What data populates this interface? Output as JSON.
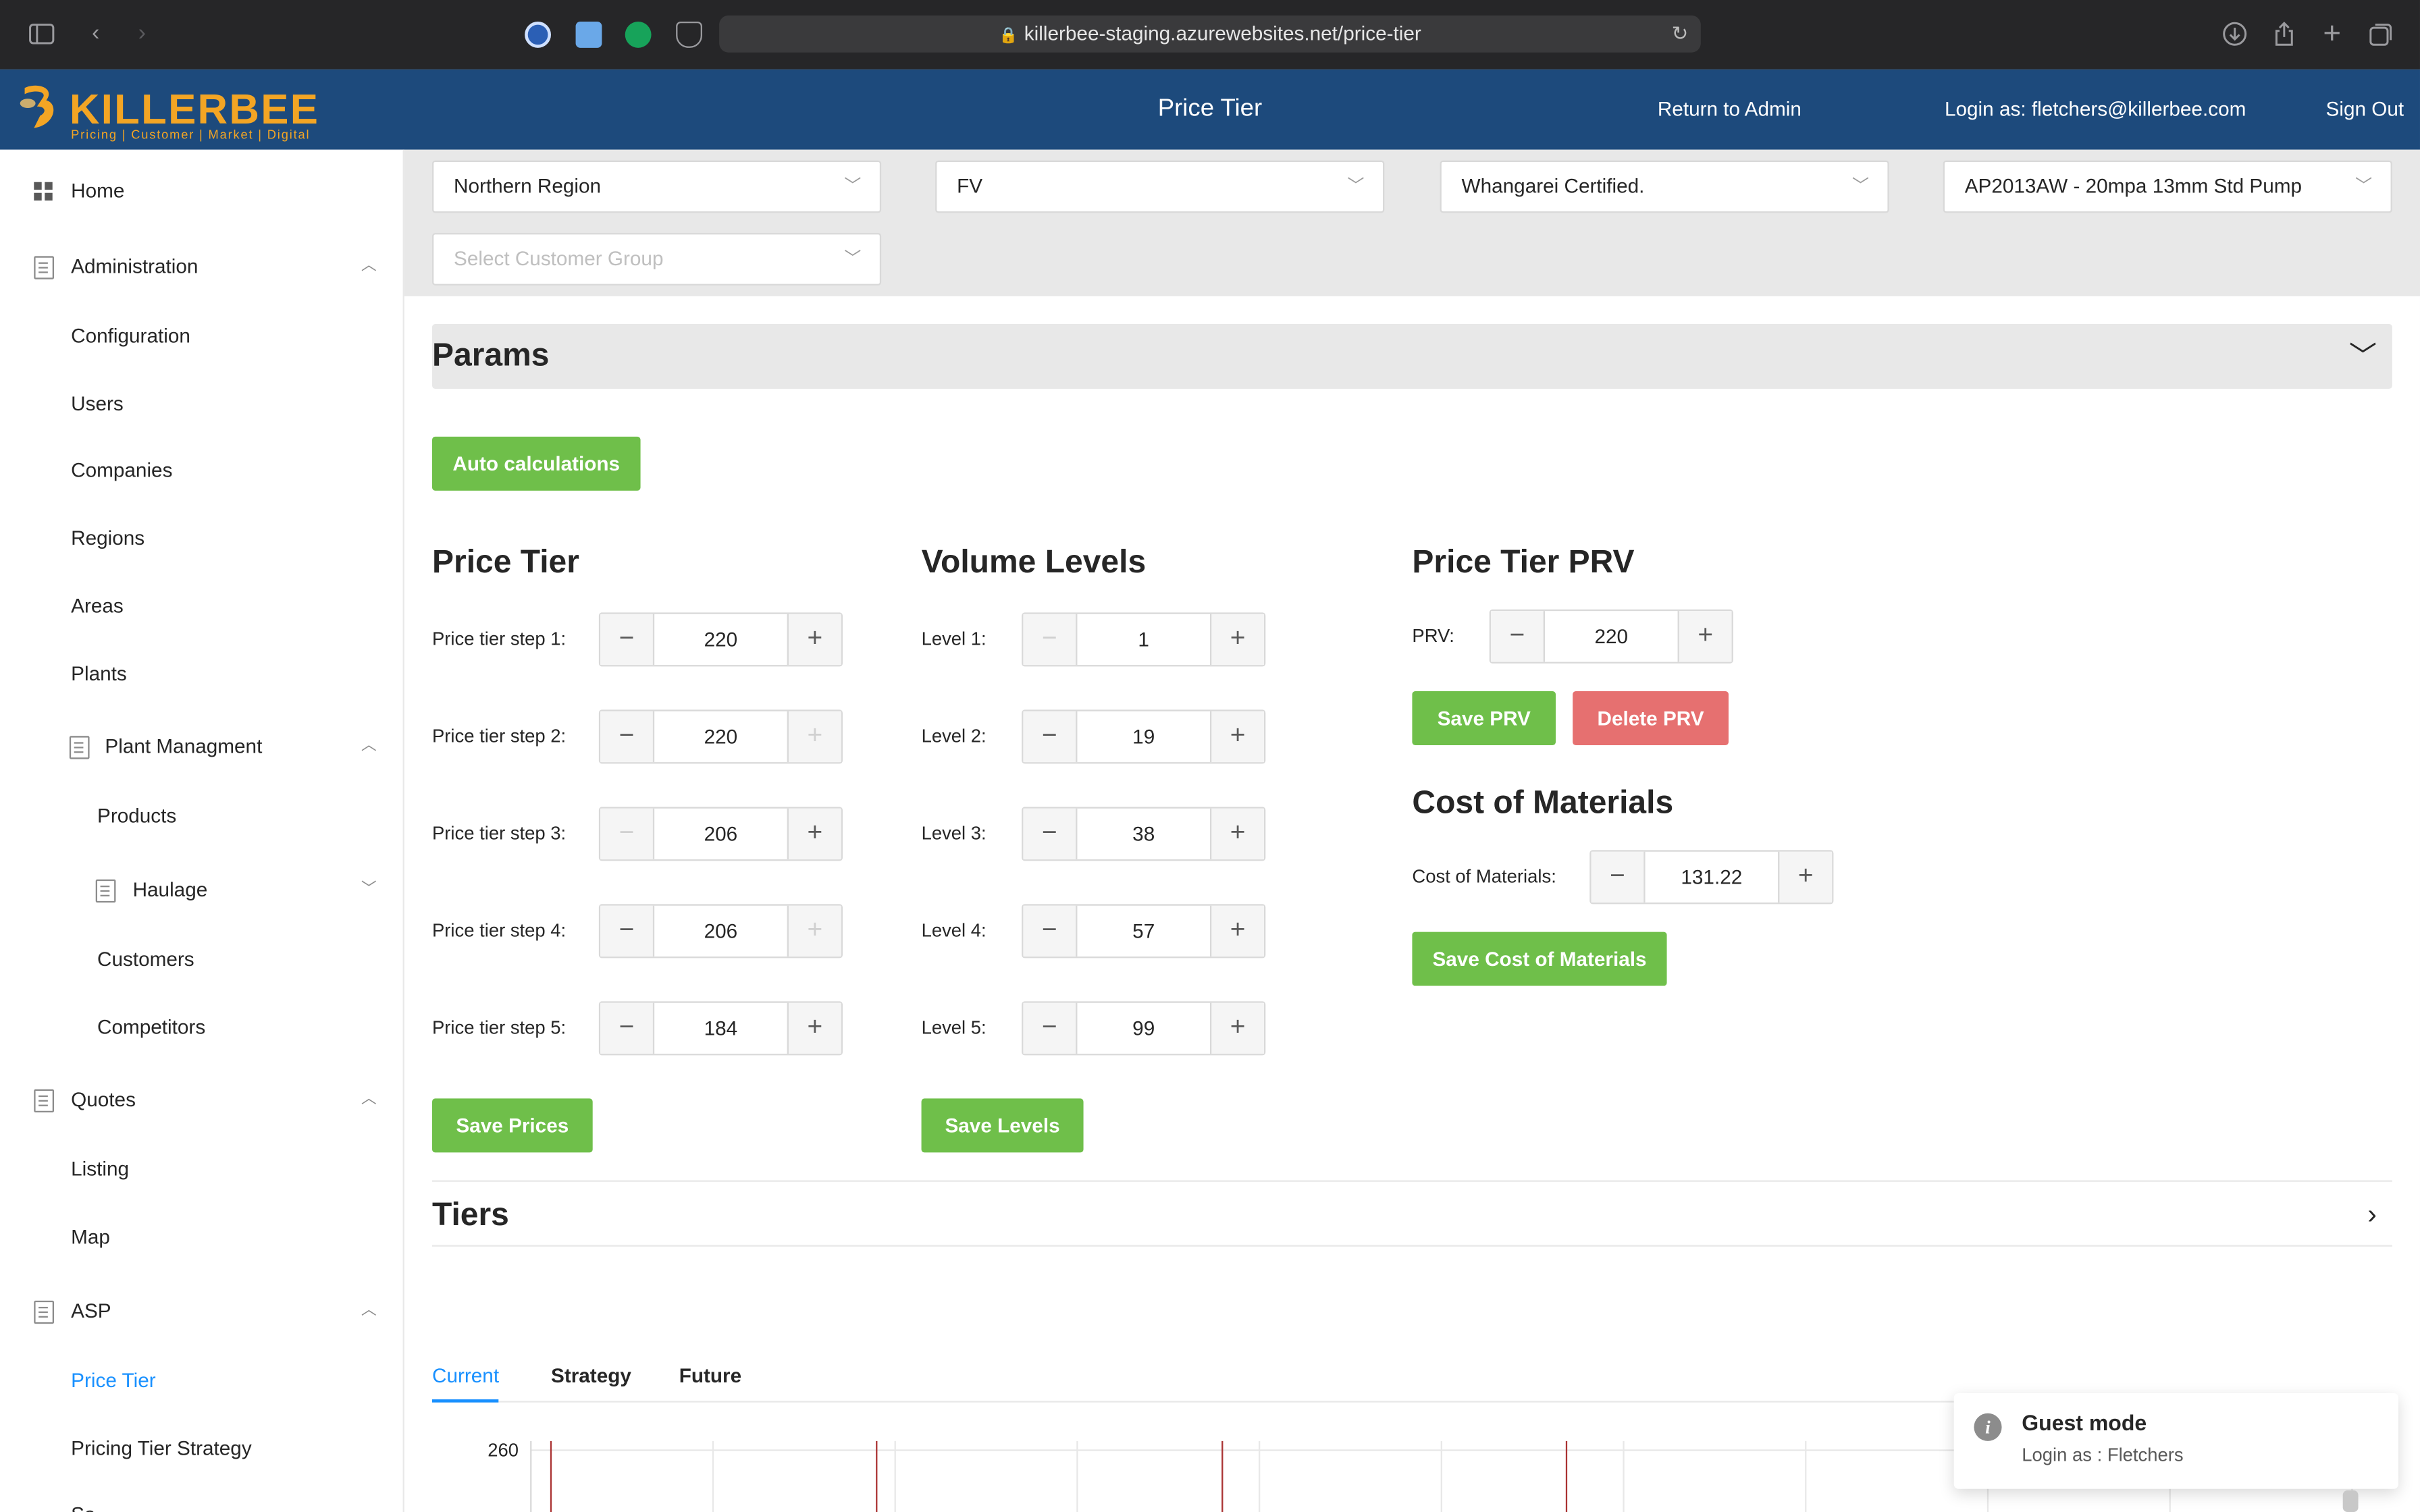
{
  "browser": {
    "url": "killerbee-staging.azurewebsites.net/price-tier"
  },
  "app": {
    "logo_text": "KILLERBEE",
    "logo_tagline": "Pricing | Customer | Market | Digital",
    "title": "Price Tier",
    "return_link": "Return to Admin",
    "login_as": "Login as: fletchers@killerbee.com",
    "sign_out": "Sign Out"
  },
  "sidebar": {
    "home": "Home",
    "administration": "Administration",
    "configuration": "Configuration",
    "users": "Users",
    "companies": "Companies",
    "regions": "Regions",
    "areas": "Areas",
    "plants": "Plants",
    "plant_management": "Plant Managment",
    "products": "Products",
    "haulage": "Haulage",
    "customers": "Customers",
    "competitors": "Competitors",
    "quotes": "Quotes",
    "listing": "Listing",
    "map": "Map",
    "asp": "ASP",
    "price_tier": "Price Tier",
    "pricing_tier_strategy": "Pricing Tier Strategy",
    "cutoff_item": "Sa......"
  },
  "filters": {
    "region": "Northern Region",
    "company": "FV",
    "plant": "Whangarei Certified.",
    "product": "AP2013AW - 20mpa 13mm Std Pump",
    "customer_group_placeholder": "Select Customer Group"
  },
  "params": {
    "title": "Params",
    "auto_calc": "Auto calculations"
  },
  "price_tier": {
    "title": "Price Tier",
    "steps": [
      {
        "label": "Price tier step 1:",
        "value": "220"
      },
      {
        "label": "Price tier step 2:",
        "value": "220"
      },
      {
        "label": "Price tier step 3:",
        "value": "206"
      },
      {
        "label": "Price tier step 4:",
        "value": "206"
      },
      {
        "label": "Price tier step 5:",
        "value": "184"
      }
    ],
    "save": "Save Prices"
  },
  "volume_levels": {
    "title": "Volume Levels",
    "levels": [
      {
        "label": "Level 1:",
        "value": "1"
      },
      {
        "label": "Level 2:",
        "value": "19"
      },
      {
        "label": "Level 3:",
        "value": "38"
      },
      {
        "label": "Level 4:",
        "value": "57"
      },
      {
        "label": "Level 5:",
        "value": "99"
      }
    ],
    "save": "Save Levels"
  },
  "prv": {
    "title": "Price Tier PRV",
    "label": "PRV:",
    "value": "220",
    "save": "Save PRV",
    "delete": "Delete PRV"
  },
  "cost_of_materials": {
    "title": "Cost of Materials",
    "label": "Cost of Materials:",
    "value": "131.22",
    "save": "Save Cost of Materials"
  },
  "tiers": {
    "title": "Tiers",
    "tabs": [
      "Current",
      "Strategy",
      "Future"
    ]
  },
  "chart_data": {
    "type": "line",
    "y_tick_top": "260"
  },
  "toast": {
    "title": "Guest mode",
    "subtitle": "Login as : Fletchers"
  },
  "colors": {
    "header_bg": "#1d4a7c",
    "logo_accent": "#f3a524",
    "btn_green": "#6fbf4a",
    "btn_red": "#e67070",
    "link_blue": "#1890ff"
  }
}
